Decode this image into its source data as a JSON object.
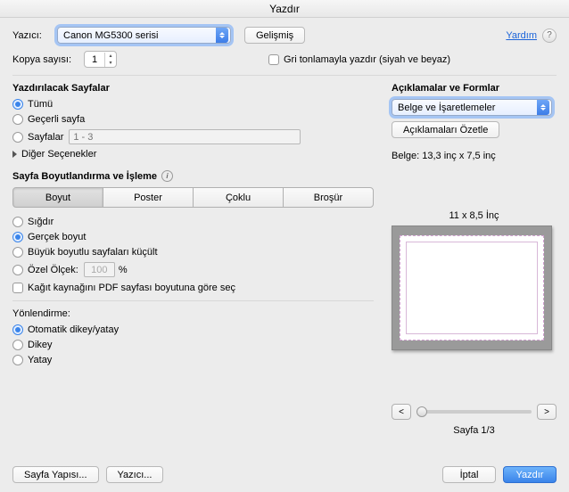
{
  "window_title": "Yazdır",
  "printer": {
    "label": "Yazıcı:",
    "value": "Canon MG5300 serisi",
    "advanced_btn": "Gelişmiş",
    "help_link": "Yardım"
  },
  "copies": {
    "label": "Kopya sayısı:",
    "value": "1",
    "grayscale_label": "Gri tonlamayla yazdır (siyah ve beyaz)"
  },
  "pages": {
    "title": "Yazdırılacak Sayfalar",
    "all": "Tümü",
    "current": "Geçerli sayfa",
    "pages_label": "Sayfalar",
    "pages_placeholder": "1 - 3",
    "more_options": "Diğer Seçenekler"
  },
  "sizing": {
    "title": "Sayfa Boyutlandırma ve İşleme",
    "tabs": {
      "size": "Boyut",
      "poster": "Poster",
      "multi": "Çoklu",
      "booklet": "Broşür"
    },
    "fit": "Sığdır",
    "actual": "Gerçek boyut",
    "shrink": "Büyük boyutlu sayfaları küçült",
    "custom": "Özel Ölçek:",
    "custom_value": "100",
    "custom_unit": "%",
    "paper_source": "Kağıt kaynağını PDF sayfası boyutuna göre seç"
  },
  "orientation": {
    "title": "Yönlendirme:",
    "auto": "Otomatik dikey/yatay",
    "portrait": "Dikey",
    "landscape": "Yatay"
  },
  "comments": {
    "title": "Açıklamalar ve Formlar",
    "select_value": "Belge ve İşaretlemeler",
    "summarize_btn": "Açıklamaları Özetle"
  },
  "preview": {
    "doc_dims": "Belge: 13,3 inç x 7,5 inç",
    "paper_dims": "11 x 8,5 İnç",
    "page_indicator": "Sayfa 1/3",
    "prev": "<",
    "next": ">"
  },
  "footer": {
    "page_setup": "Sayfa Yapısı...",
    "printer_btn": "Yazıcı...",
    "cancel": "İptal",
    "print": "Yazdır"
  }
}
